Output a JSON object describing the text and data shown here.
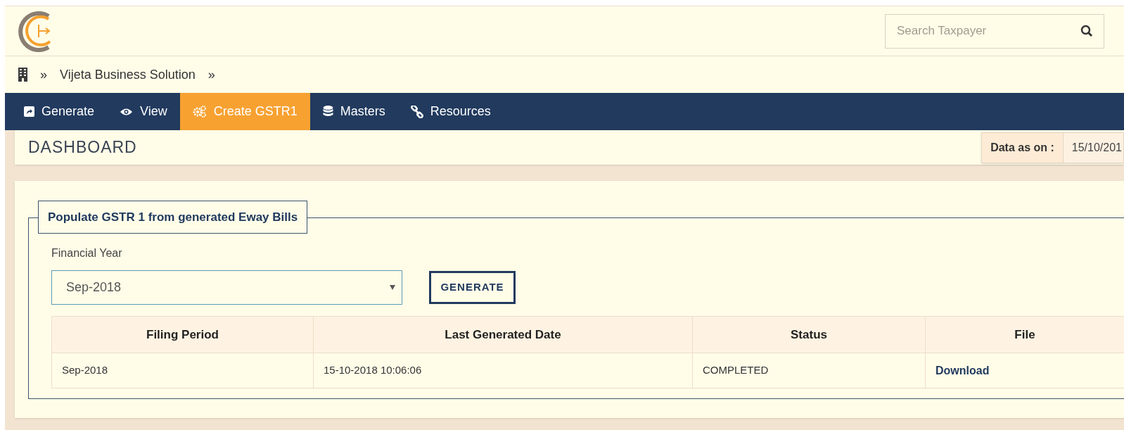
{
  "header": {
    "search": {
      "placeholder": "Search Taxpayer"
    }
  },
  "breadcrumb": {
    "items": [
      "»",
      "Vijeta Business Solution",
      "»"
    ]
  },
  "nav": [
    {
      "label": "Generate",
      "selected": false
    },
    {
      "label": "View",
      "selected": false
    },
    {
      "label": "Create GSTR1",
      "selected": true
    },
    {
      "label": "Masters",
      "selected": false
    },
    {
      "label": "Resources",
      "selected": false
    }
  ],
  "page_title": "DASHBOARD",
  "data_as_on": {
    "label": "Data as on :",
    "value": "15/10/201"
  },
  "panel": {
    "legend": "Populate GSTR 1 from generated Eway Bills",
    "field_label": "Financial Year",
    "select_value": "Sep-2018",
    "button": "GENERATE",
    "table": {
      "columns": [
        "Filing Period",
        "Last Generated Date",
        "Status",
        "File"
      ],
      "rows": [
        [
          "Sep-2018",
          "15-10-2018 10:06:06",
          "COMPLETED",
          "Download"
        ]
      ]
    }
  }
}
